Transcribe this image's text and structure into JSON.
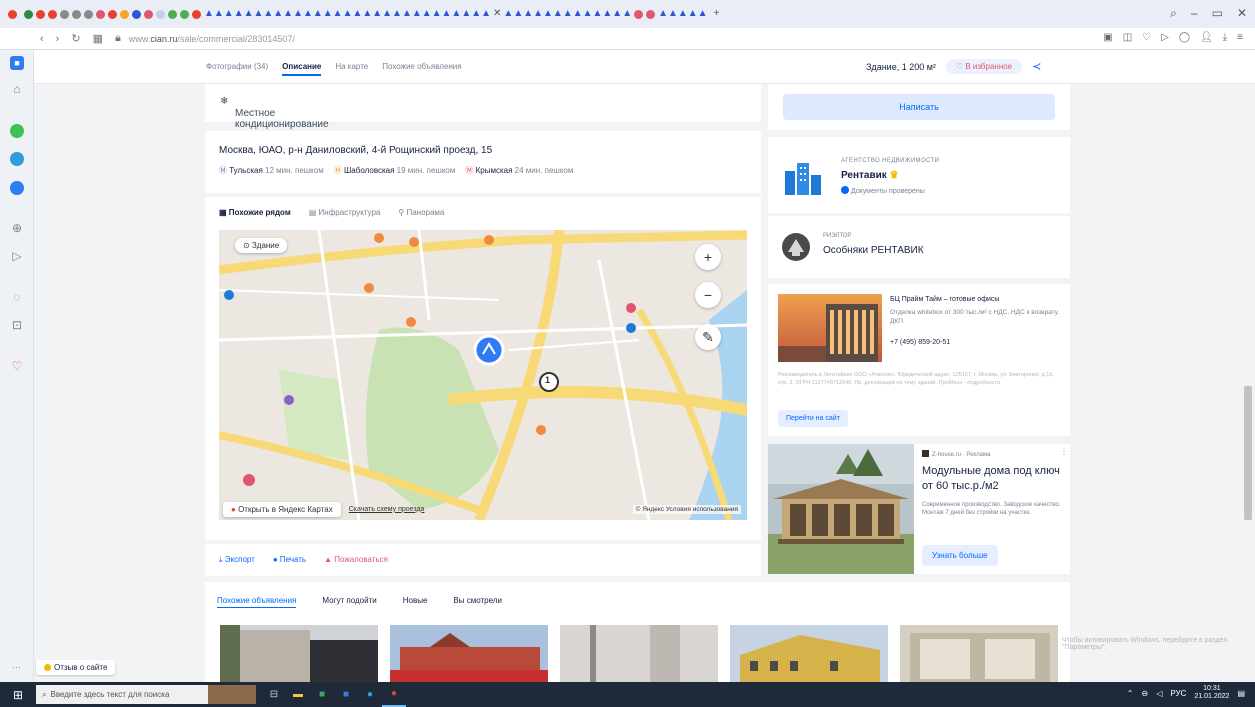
{
  "browser": {
    "url_prefix": "www.",
    "url_domain": "cian.ru",
    "url_path": "/sale/commercial/283014507/"
  },
  "header": {
    "tabs": [
      "Фотографии (34)",
      "Описание",
      "На карте",
      "Похожие объявления"
    ],
    "area": "Здание, 1 200 м²",
    "favorite": "В избранное"
  },
  "amenity": "Местное кондиционирование",
  "address": {
    "line": "Москва, ЮАО, р-н Даниловский, 4-й Рощинский проезд, 15",
    "metro": [
      {
        "station": "Тульская",
        "walk": "12 мин. пешком"
      },
      {
        "station": "Шаболовская",
        "walk": "19 мин. пешком"
      },
      {
        "station": "Крымская",
        "walk": "24 мин. пешком"
      }
    ]
  },
  "map": {
    "tabs": [
      "Похожие рядом",
      "Инфраструктура",
      "Панорама"
    ],
    "building_chip": "Здание",
    "open_yandex": "Открыть в Яндекс Картах",
    "download": "Скачать схему проезда",
    "terms": "© Яндекс Условия использования",
    "cluster_count": "1"
  },
  "actions": {
    "export": "Экспорт",
    "print": "Печать",
    "complain": "Пожаловаться"
  },
  "sidebar_right": {
    "write": "Написать",
    "agency": {
      "type": "АГЕНТСТВО НЕДВИЖИМОСТИ",
      "name": "Рентавик",
      "verified": "Документы проверены"
    },
    "realtor": {
      "type": "РИЭЛТОР",
      "name": "Особняки РЕНТАВИК"
    },
    "ad1": {
      "title": "БЦ Прайм Тайм – готовые офисы",
      "desc": "Отделка whitebox от 300 тыс./м² с НДС. НДС к возврату. ДКП",
      "phone": "+7 (495) 859-20-51",
      "legal": "Рекламодатель в Легатийнах ООО «Атантик». Юридический адрес: 125167, г. Москва, ул. Викторенко, д.16, стр. 3. ОГРН 1127746712048. Пр. деклараций на тему зданий. ПроМенн - подробности",
      "button": "Перейти на сайт"
    },
    "ad2": {
      "source": "Z-house.ru · Реклама",
      "title": "Модульные дома под ключ от 60 тыс.р./м2",
      "desc": "Современное производство. Заводское качество. Монтаж 7 дней без стройки на участке.",
      "button": "Узнать больше"
    }
  },
  "similar": {
    "tabs": [
      "Похожие объявления",
      "Могут подойти",
      "Новые",
      "Вы смотрели"
    ]
  },
  "feedback": "Отзыв о сайте",
  "activate_hint": "Чтобы активировать Windows, перейдите в раздел \"Параметры\".",
  "taskbar": {
    "search_placeholder": "Введите здесь текст для поиска",
    "lang": "РУС",
    "time": "10:31",
    "date": "21.01.2022"
  }
}
